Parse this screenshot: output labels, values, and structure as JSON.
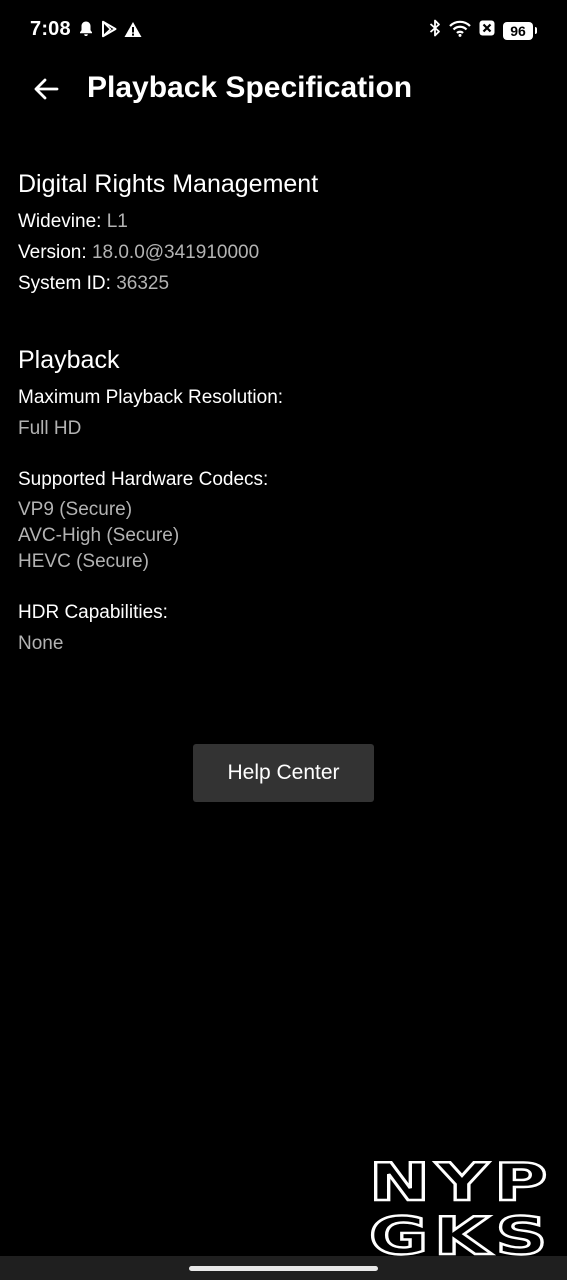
{
  "status_bar": {
    "time": "7:08",
    "left_icons": [
      "bell-icon",
      "play-store-icon",
      "warning-icon"
    ],
    "right_icons": [
      "bluetooth-icon",
      "wifi-icon",
      "close-box-icon"
    ],
    "battery": "96"
  },
  "header": {
    "back_icon": "arrow-left-icon",
    "title": "Playback Specification"
  },
  "drm": {
    "heading": "Digital Rights Management",
    "widevine_label": "Widevine:",
    "widevine_value": "L1",
    "version_label": "Version:",
    "version_value": "18.0.0@341910000",
    "system_id_label": "System ID:",
    "system_id_value": "36325"
  },
  "playback": {
    "heading": "Playback",
    "max_resolution_label": "Maximum Playback Resolution:",
    "max_resolution_value": "Full HD",
    "codecs_label": "Supported Hardware Codecs:",
    "codecs": [
      "VP9 (Secure)",
      "AVC-High (Secure)",
      "HEVC (Secure)"
    ],
    "hdr_label": "HDR Capabilities:",
    "hdr_value": "None"
  },
  "help_button": {
    "label": "Help Center"
  },
  "watermark": {
    "line1": "NYP",
    "line2": "GKS"
  },
  "colors": {
    "background": "#000000",
    "primary_text": "#ffffff",
    "secondary_text": "#b3b3b3",
    "button_bg": "#333333"
  }
}
